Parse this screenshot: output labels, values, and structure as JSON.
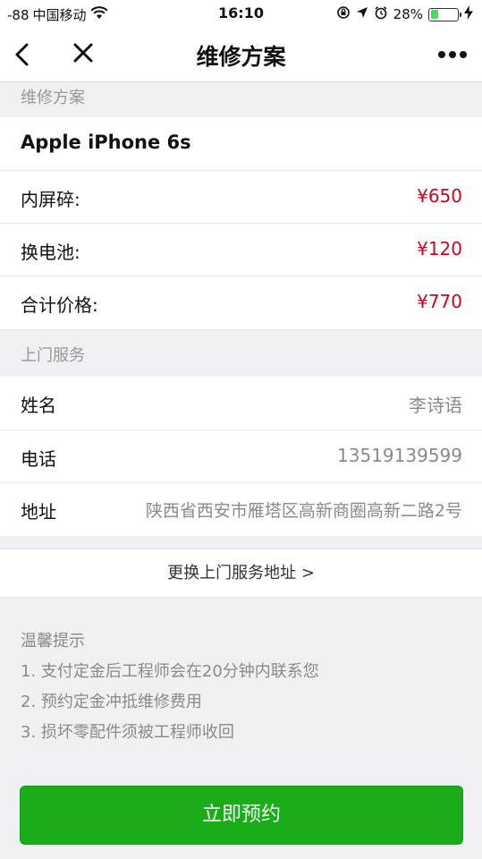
{
  "status": {
    "signal": "-88",
    "carrier": "中国移动",
    "time": "16:10",
    "battery": "28%",
    "battery_level": 0.28
  },
  "nav": {
    "title": "维修方案",
    "icons": [
      "chevron-left-icon",
      "close-icon",
      "more-icon"
    ]
  },
  "plan": {
    "section_title": "维修方案",
    "device": "Apple iPhone 6s",
    "items": [
      {
        "label": "内屏碎:",
        "price": "¥650"
      },
      {
        "label": "换电池:",
        "price": "¥120"
      }
    ],
    "total_label": "合计价格:",
    "total_price": "¥770"
  },
  "service": {
    "section_title": "上门服务",
    "name_label": "姓名",
    "name_value": "李诗语",
    "phone_label": "电话",
    "phone_value": "13519139599",
    "address_label": "地址",
    "address_value": "陕西省西安市雁塔区高新商圈高新二路2号",
    "change_address": "更换上门服务地址 >"
  },
  "tips": {
    "title": "温馨提示",
    "lines": [
      "1. 支付定金后工程师会在20分钟内联系您",
      "2. 预约定金冲抵维修费用",
      "3. 损坏零配件须被工程师收回"
    ]
  },
  "action": {
    "book_label": "立即预约"
  },
  "colors": {
    "price": "#d0021b",
    "button": "#1aad19",
    "battery": "#4cd964"
  }
}
